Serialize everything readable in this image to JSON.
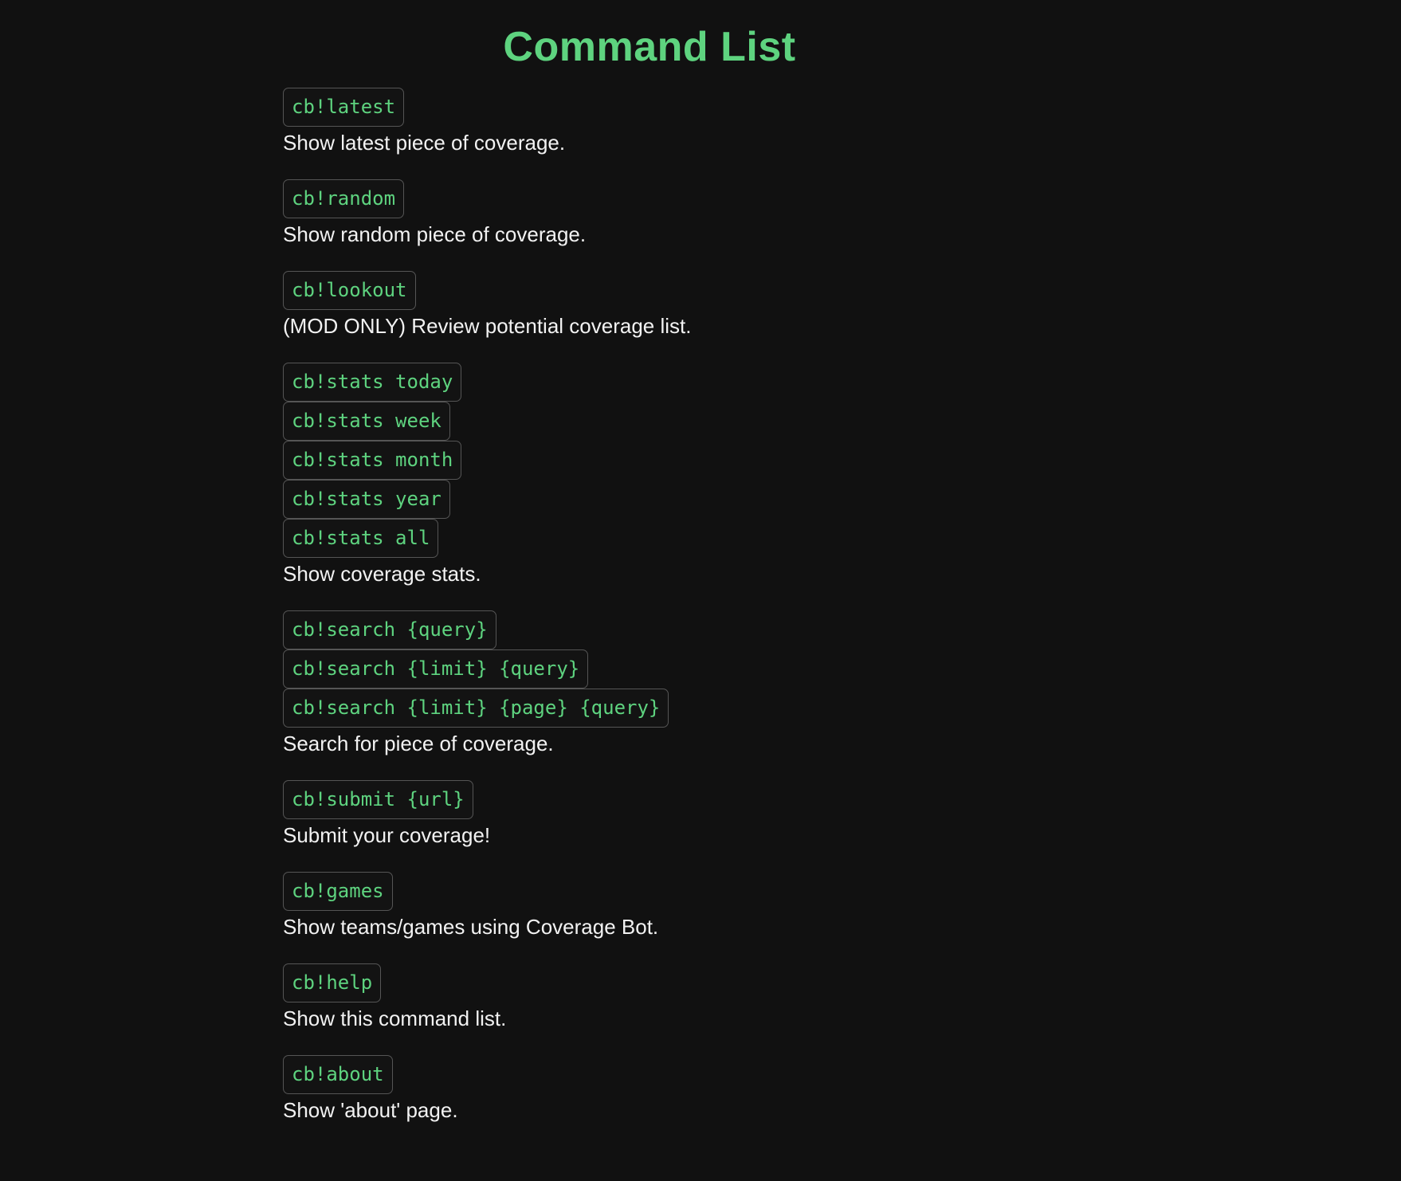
{
  "page": {
    "title": "Command List",
    "accent_color": "#5ed37f",
    "background_color": "#111111",
    "description_color": "#f2f2f2",
    "code_border_color": "#555555",
    "code_background_color": "#131313"
  },
  "commands": [
    {
      "id": "latest",
      "usages": [
        "cb!latest"
      ],
      "description": "Show latest piece of coverage."
    },
    {
      "id": "random",
      "usages": [
        "cb!random"
      ],
      "description": "Show random piece of coverage."
    },
    {
      "id": "lookout",
      "usages": [
        "cb!lookout"
      ],
      "description": "(MOD ONLY) Review potential coverage list."
    },
    {
      "id": "stats",
      "usages": [
        "cb!stats today",
        "cb!stats week",
        "cb!stats month",
        "cb!stats year",
        "cb!stats all"
      ],
      "description": "Show coverage stats."
    },
    {
      "id": "search",
      "usages": [
        "cb!search {query}",
        "cb!search {limit} {query}",
        "cb!search {limit} {page} {query}"
      ],
      "description": "Search for piece of coverage."
    },
    {
      "id": "submit",
      "usages": [
        "cb!submit {url}"
      ],
      "description": "Submit your coverage!"
    },
    {
      "id": "games",
      "usages": [
        "cb!games"
      ],
      "description": "Show teams/games using Coverage Bot."
    },
    {
      "id": "help",
      "usages": [
        "cb!help"
      ],
      "description": "Show this command list."
    },
    {
      "id": "about",
      "usages": [
        "cb!about"
      ],
      "description": "Show 'about' page."
    }
  ]
}
